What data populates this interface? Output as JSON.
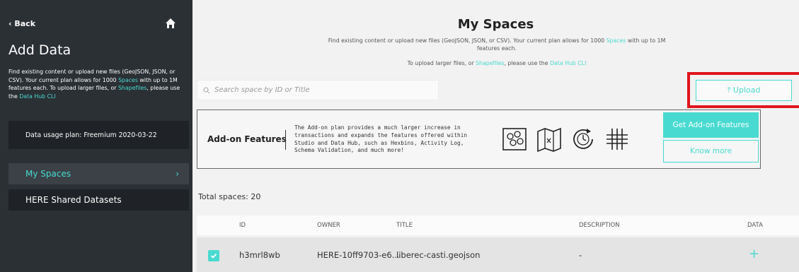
{
  "sidebar": {
    "back_label": "‹ Back",
    "title": "Add Data",
    "desc_part1": "Find existing content or upload new files (GeoJSON, JSON, or CSV). Your current plan allows for 1000 ",
    "desc_link1": "Spaces",
    "desc_part2": " with up to 1M features each. To upload larger files, or ",
    "desc_link2": "Shapefiles",
    "desc_part3": ", please use the ",
    "desc_link3": "Data Hub CLI",
    "plan": "Data usage plan: Freemium 2020-03-22",
    "nav": [
      {
        "label": "My Spaces",
        "chevron": "›"
      },
      {
        "label": "HERE Shared Datasets"
      }
    ]
  },
  "main": {
    "title": "My Spaces",
    "desc_part1": "Find existing content or upload new files (GeoJSON, JSON, or CSV). Your current plan allows for 1000 ",
    "desc_link1": "Spaces",
    "desc_part2": " with up to 1M features each.",
    "desc2_part1": "To upload larger files, or ",
    "desc2_link1": "Shapefiles",
    "desc2_part2": ", please use the ",
    "desc2_link2": "Data Hub CLI",
    "search_placeholder": "Search space by ID or Title",
    "upload_label": "⤒  Upload"
  },
  "addon": {
    "title": "Add-on Features",
    "text": "The Add-on plan provides a much larger increase in transactions and expands the features offered within Studio and Data Hub, such as Hexbins, Activity Log, Schema Validation, and much more!",
    "get_label": "Get Add-on Features",
    "know_label": "Know more",
    "icons": [
      "hexbin-icon",
      "map-icon",
      "activity-log-icon",
      "grid-icon"
    ]
  },
  "table": {
    "total": "Total spaces: 20",
    "headers": [
      "ID",
      "OWNER",
      "TITLE",
      "DESCRIPTION",
      "DATA"
    ],
    "rows": [
      {
        "id": "h3mrl8wb",
        "owner": "HERE-10ff9703-e6...",
        "title": "liberec-casti.geojson",
        "description": "-",
        "data": "+"
      }
    ]
  },
  "colors": {
    "accent": "#48dad0",
    "sidebar": "#2b3035",
    "highlight": "#e0151d"
  }
}
